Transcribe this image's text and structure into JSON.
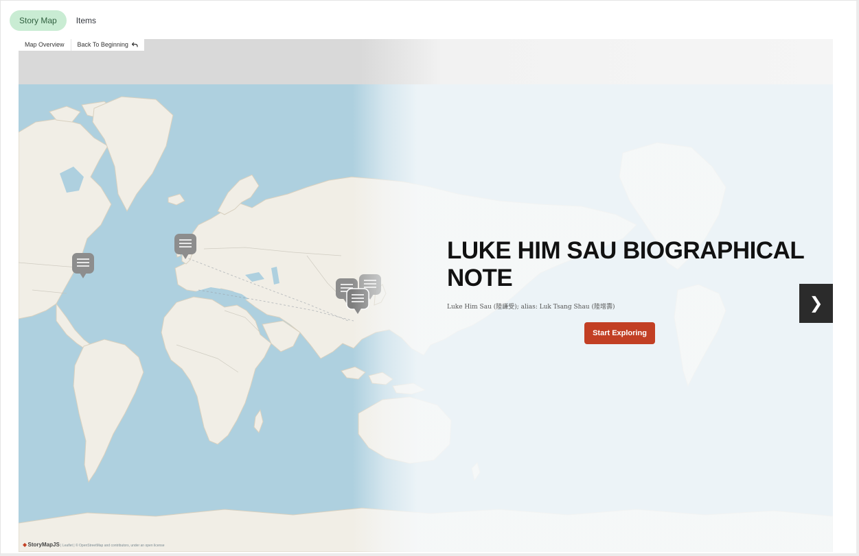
{
  "tabs": [
    {
      "label": "Story Map",
      "active": true
    },
    {
      "label": "Items",
      "active": false
    }
  ],
  "menu": {
    "overview_label": "Map Overview",
    "back_label": "Back To Beginning",
    "back_icon": "undo-arrow-icon"
  },
  "slide": {
    "title": "LUKE HIM SAU BIOGRAPHICAL NOTE",
    "subtitle": "Luke Him Sau (陸謙受); alias: Luk Tsang Shau (陸增壽)",
    "start_label": "Start Exploring"
  },
  "next_icon": "chevron-right-icon",
  "next_glyph": "❯",
  "attribution": {
    "brand": "StoryMapJS",
    "text": "| Leaflet | © OpenStreetMap and contributors, under an open license"
  },
  "colors": {
    "accent_red": "#c23f24",
    "tab_active_bg": "#c9ecd3",
    "ocean": "#aed0df",
    "land": "#f1eee6",
    "marker": "#8d8d8d"
  }
}
